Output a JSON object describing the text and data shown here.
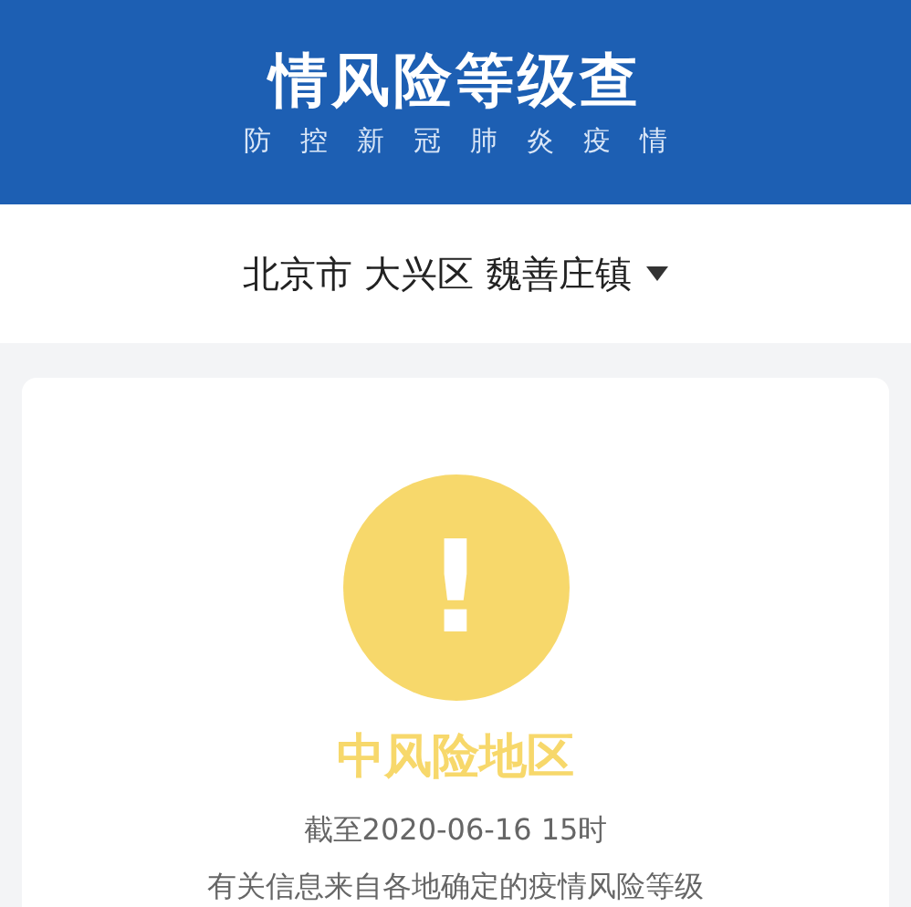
{
  "header": {
    "title": "情风险等级查",
    "subtitle": "防控新冠肺炎疫情"
  },
  "location": {
    "text": "北京市 大兴区 魏善庄镇"
  },
  "result": {
    "label": "中风险地区",
    "color": "#f7d86b",
    "mark": "!",
    "as_of": "截至2020-06-16 15时",
    "note": "有关信息来自各地确定的疫情风险等级"
  }
}
